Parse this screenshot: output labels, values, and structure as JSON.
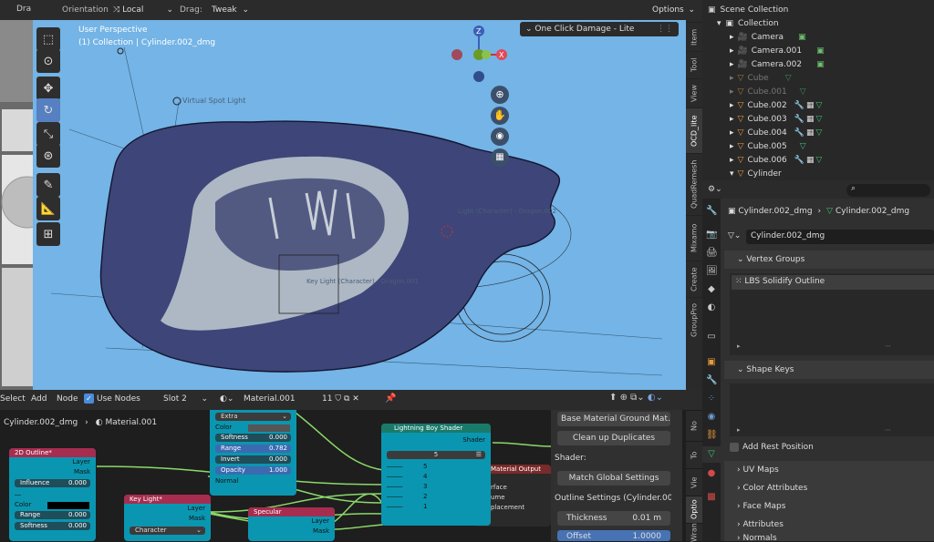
{
  "viewport_header": {
    "left_label": "Dra",
    "orientation_label": "Orientation:",
    "orientation_value": "Local",
    "drag_label": "Drag:",
    "drag_value": "Tweak",
    "options_label": "Options"
  },
  "viewport": {
    "perspective": "User Perspective",
    "collection_info": "(1) Collection | Cylinder.002_dmg",
    "spot_light_label": "Virtual Spot Light",
    "faded_label_1": "Light (Character) - Dragon.002",
    "faded_label_2": "Key Light (Character) - Dragon.001",
    "gizmo_axes": {
      "z": "Z",
      "x": "X"
    }
  },
  "one_click_panel": {
    "title": "One Click Damage - Lite"
  },
  "npanel_tabs": [
    "Item",
    "Tool",
    "View",
    "OCD_lite",
    "QuadRemesh",
    "Mixamo",
    "Create",
    "GroupPro"
  ],
  "outliner": {
    "root": "Scene Collection",
    "collection": "Collection",
    "items": [
      {
        "name": "Camera",
        "type": "camera",
        "dim": false
      },
      {
        "name": "Camera.001",
        "type": "camera",
        "dim": false
      },
      {
        "name": "Camera.002",
        "type": "camera",
        "dim": false
      },
      {
        "name": "Cube",
        "type": "mesh",
        "dim": true
      },
      {
        "name": "Cube.001",
        "type": "mesh",
        "dim": true
      },
      {
        "name": "Cube.002",
        "type": "mesh",
        "dim": false
      },
      {
        "name": "Cube.003",
        "type": "mesh",
        "dim": false
      },
      {
        "name": "Cube.004",
        "type": "mesh",
        "dim": false
      },
      {
        "name": "Cube.005",
        "type": "mesh",
        "dim": false
      },
      {
        "name": "Cube.006",
        "type": "mesh",
        "dim": false
      },
      {
        "name": "Cylinder",
        "type": "mesh",
        "dim": false
      }
    ]
  },
  "properties": {
    "breadcrumb_object": "Cylinder.002_dmg",
    "breadcrumb_data": "Cylinder.002_dmg",
    "mesh_name": "Cylinder.002_dmg",
    "vertex_groups_title": "Vertex Groups",
    "vertex_group_item": "LBS Solidify Outline",
    "shape_keys_title": "Shape Keys",
    "add_rest_position": "Add Rest Position",
    "uv_maps": "UV Maps",
    "color_attributes": "Color Attributes",
    "face_maps": "Face Maps",
    "attributes": "Attributes",
    "normals": "Normals"
  },
  "node_header": {
    "select": "Select",
    "add": "Add",
    "node": "Node",
    "use_nodes": "Use Nodes",
    "slot": "Slot 2",
    "material": "Material.001",
    "users": "11"
  },
  "node_breadcrumb": {
    "object": "Cylinder.002_dmg",
    "material": "Material.001"
  },
  "nodes": {
    "outline": {
      "title": "2D Outline*",
      "layer": "Layer",
      "mask": "Mask",
      "influence_label": "Influence",
      "influence_value": "0.000",
      "color": "Color",
      "range_label": "Range",
      "range_value": "0.000",
      "softness": "Softness",
      "softness_value": "0.000"
    },
    "extra": {
      "dropdown": "Extra",
      "color": "Color",
      "softness_label": "Softness",
      "softness_value": "0.000",
      "range_label": "Range",
      "range_value": "0.782",
      "invert_label": "Invert",
      "invert_value": "0.000",
      "opacity_label": "Opacity",
      "opacity_value": "1.000",
      "normal": "Normal"
    },
    "key_light": {
      "title": "Key Light*",
      "layer": "Layer",
      "mask": "Mask",
      "dropdown": "Character"
    },
    "specular": {
      "title": "Specular",
      "layer": "Layer",
      "mask": "Mask"
    },
    "lightning": {
      "title": "Lightning Boy Shader",
      "shader": "Shader",
      "count": "5",
      "inputs": [
        "5",
        "4",
        "3",
        "2",
        "1"
      ]
    },
    "material_output": {
      "title": "Material Output",
      "rows": [
        "rface",
        "ume",
        "placement"
      ]
    }
  },
  "side_panel": {
    "base_material": "Base Material  Ground Mat...",
    "cleanup": "Clean up Duplicates",
    "shader_label": "Shader:",
    "match_global": "Match Global Settings",
    "outline_settings": "Outline Settings (Cylinder.002...",
    "thickness_label": "Thickness",
    "thickness_value": "0.01 m",
    "offset_label": "Offset",
    "offset_value": "1.0000"
  },
  "node_side_tabs": [
    "No",
    "To",
    "Vie",
    "Optio",
    "Wran"
  ]
}
